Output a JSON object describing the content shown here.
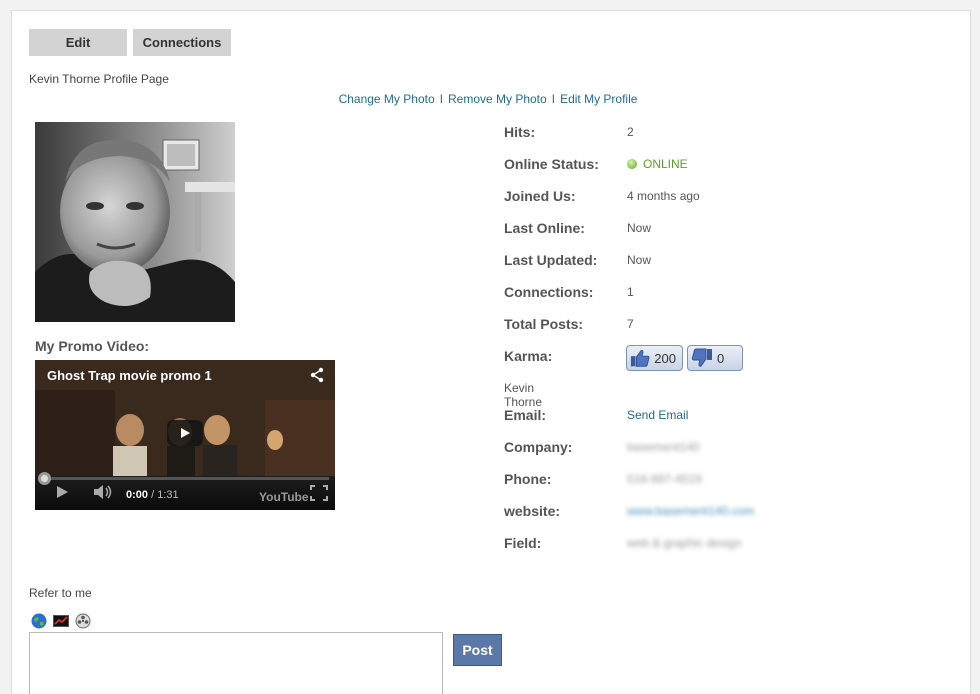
{
  "tabs": {
    "edit": "Edit",
    "connections": "Connections"
  },
  "page_title": "Kevin Thorne Profile Page",
  "photo_actions": {
    "change": "Change My Photo",
    "remove": "Remove My Photo",
    "edit_profile": "Edit My Profile",
    "separator": "l"
  },
  "promo": {
    "label": "My Promo Video:",
    "video_title": "Ghost Trap movie promo 1",
    "current_time": "0:00",
    "time_separator": " / ",
    "duration": "1:31",
    "brand": "YouTube"
  },
  "info": {
    "hits_label": "Hits:",
    "hits_value": "2",
    "status_label": "Online Status:",
    "status_value": "ONLINE",
    "joined_label": "Joined Us:",
    "joined_value": "4 months ago",
    "last_online_label": "Last Online:",
    "last_online_value": "Now",
    "last_updated_label": "Last Updated:",
    "last_updated_value": "Now",
    "connections_label": "Connections:",
    "connections_value": "1",
    "posts_label": "Total Posts:",
    "posts_value": "7",
    "karma_label": "Karma:",
    "karma_up": "200",
    "karma_down": "0",
    "name": "Kevin Thorne",
    "email_label": "Email:",
    "email_value": "Send Email",
    "company_label": "Company:",
    "company_value": "basement140",
    "phone_label": "Phone:",
    "phone_value": "516-997-4519",
    "website_label": "website:",
    "website_value": "www.basement140.com",
    "field_label": "Field:",
    "field_value": "web & graphic design"
  },
  "refer": {
    "label": "Refer to me"
  },
  "comment": {
    "placeholder": "",
    "post_label": "Post"
  },
  "colors": {
    "link": "#1f6d8c",
    "online": "#5aa02c",
    "post_button": "#5b78a8",
    "tab_bg": "#d3d3d3"
  }
}
